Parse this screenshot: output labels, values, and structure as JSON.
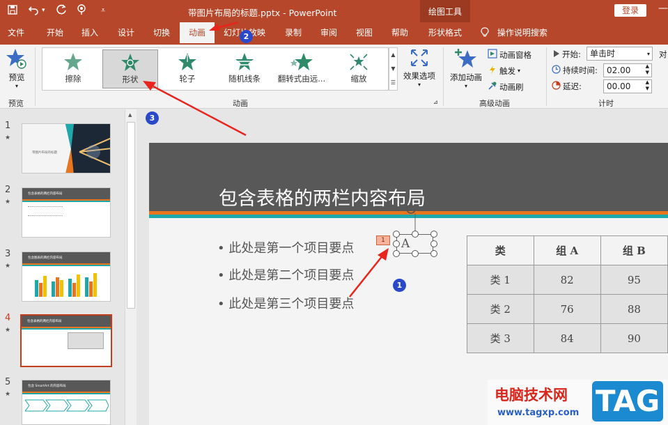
{
  "titlebar": {
    "quick_access": [
      "save-icon",
      "undo-icon",
      "redo-icon",
      "touch-mode-icon",
      "customize-icon"
    ],
    "file_title": "带图片布局的标题.pptx",
    "app_name": "PowerPoint",
    "title_sep": " - ",
    "contextual_group": "绘图工具",
    "login_label": "登录"
  },
  "tabs": [
    {
      "label": "文件"
    },
    {
      "label": "开始"
    },
    {
      "label": "插入"
    },
    {
      "label": "设计"
    },
    {
      "label": "切换"
    },
    {
      "label": "动画",
      "active": true
    },
    {
      "label": "幻灯片放映"
    },
    {
      "label": "录制"
    },
    {
      "label": "审阅"
    },
    {
      "label": "视图"
    },
    {
      "label": "帮助"
    },
    {
      "label": "形状格式"
    }
  ],
  "tell_me": "操作说明搜索",
  "ribbon": {
    "preview": {
      "label": "预览",
      "group": "预览"
    },
    "animation_gallery": {
      "items": [
        {
          "label": "擦除"
        },
        {
          "label": "形状",
          "selected": true
        },
        {
          "label": "轮子"
        },
        {
          "label": "随机线条"
        },
        {
          "label": "翻转式由远..."
        },
        {
          "label": "缩放"
        }
      ],
      "group": "动画"
    },
    "effect_options": "效果选项",
    "advanced": {
      "add_animation": "添加动画",
      "animation_pane": "动画窗格",
      "trigger": "触发",
      "painter": "动画刷",
      "group": "高级动画"
    },
    "timing": {
      "start_label": "开始:",
      "start_value": "单击时",
      "duration_label": "持续时间:",
      "duration_value": "02.00",
      "delay_label": "延迟:",
      "delay_value": "00.00",
      "group": "计时",
      "reorder_partial": "对"
    }
  },
  "slides": [
    {
      "num": "1",
      "star": "★",
      "title": "带图片布局的标题"
    },
    {
      "num": "2",
      "star": "★",
      "title": "包含表格的两栏内容布局"
    },
    {
      "num": "3",
      "star": "★",
      "title": "包含图表的两栏内容布局"
    },
    {
      "num": "4",
      "star": "★",
      "title": "包含表格的两栏内容布局"
    },
    {
      "num": "5",
      "star": "★",
      "title": "包含 SmartArt 的内容布局"
    }
  ],
  "slide": {
    "title": "包含表格的两栏内容布局",
    "bullets": [
      "此处是第一个项目要点",
      "此处是第二个项目要点",
      "此处是第三个项目要点"
    ],
    "anim_tag": "1",
    "shape_text": "A",
    "table": {
      "headers": [
        "类",
        "组 A",
        "组 B"
      ],
      "rows": [
        [
          "类 1",
          "82",
          "95"
        ],
        [
          "类 2",
          "76",
          "88"
        ],
        [
          "类 3",
          "84",
          "90"
        ]
      ]
    }
  },
  "annotations": {
    "step1": "1",
    "step2": "2",
    "step3": "3"
  },
  "watermark": {
    "cn": "电脑技术网",
    "url": "www.tagxp.com",
    "tag": "TAG"
  },
  "colors": {
    "accent": "#b7472a",
    "gallery_star": "#2f8a6a",
    "bullet": "#555555",
    "arrow": "#e8251d",
    "badge": "#2a49c9"
  }
}
